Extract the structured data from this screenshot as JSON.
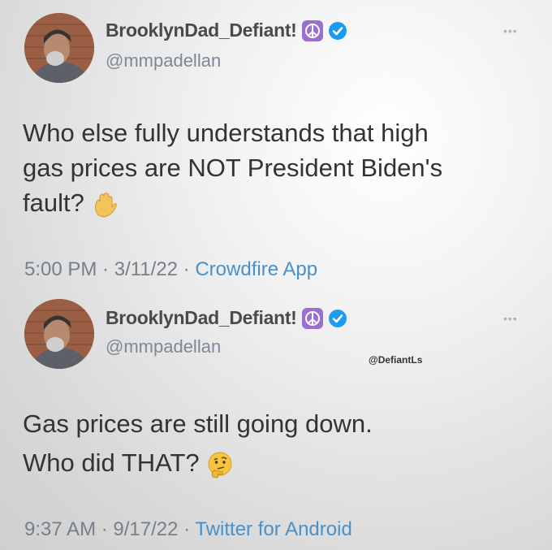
{
  "tweets": [
    {
      "display_name": "BrooklynDad_Defiant!",
      "handle": "@mmpadellan",
      "text_lines": [
        "Who else fully understands that high",
        "gas prices are NOT President Biden's",
        "fault?"
      ],
      "emoji": "raised-hand",
      "time": "5:00 PM",
      "sep1": " · ",
      "date": "3/11/22",
      "sep2": " · ",
      "source": "Crowdfire App"
    },
    {
      "display_name": "BrooklynDad_Defiant!",
      "handle": "@mmpadellan",
      "text_lines": [
        "Gas prices are still going down.",
        "Who did THAT?"
      ],
      "emoji": "thinking-face",
      "time": "9:37 AM",
      "sep1": " · ",
      "date": "9/17/22",
      "sep2": " · ",
      "source": "Twitter for Android"
    }
  ],
  "watermark": "@DefiantLs",
  "colors": {
    "verified": "#1d9bf0",
    "peace_bg": "#9b6fcf",
    "link": "#4a90c9"
  }
}
